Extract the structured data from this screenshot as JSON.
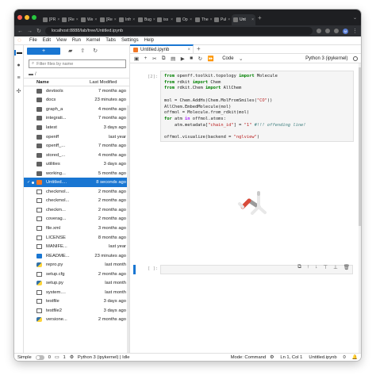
{
  "browser": {
    "tabs": [
      {
        "label": "[PR"
      },
      {
        "label": "[Re"
      },
      {
        "label": "We"
      },
      {
        "label": "[Re"
      },
      {
        "label": "Infr"
      },
      {
        "label": "Bug"
      },
      {
        "label": "iss"
      },
      {
        "label": "Op"
      },
      {
        "label": "The"
      },
      {
        "label": "Pul"
      },
      {
        "label": "Unt",
        "active": true
      }
    ],
    "url": "localhost:8888/lab/tree/Untitled.ipynb",
    "avatar": "M"
  },
  "menu": [
    "File",
    "Edit",
    "View",
    "Run",
    "Kernel",
    "Tabs",
    "Settings",
    "Help"
  ],
  "filebrowser": {
    "new_label": "+",
    "filter_placeholder": "Filter files by name",
    "breadcrumb": "/",
    "col_name": "Name",
    "col_modified": "Last Modified",
    "files": [
      {
        "name": "devtools",
        "modified": "7 months ago",
        "type": "folder"
      },
      {
        "name": "docs",
        "modified": "23 minutes ago",
        "type": "folder"
      },
      {
        "name": "graph_a",
        "modified": "4 months ago",
        "type": "folder"
      },
      {
        "name": "integrati...",
        "modified": "7 months ago",
        "type": "folder"
      },
      {
        "name": "latest",
        "modified": "3 days ago",
        "type": "folder"
      },
      {
        "name": "openff",
        "modified": "last year",
        "type": "folder"
      },
      {
        "name": "openff_...",
        "modified": "7 months ago",
        "type": "folder"
      },
      {
        "name": "stored_...",
        "modified": "4 months ago",
        "type": "folder"
      },
      {
        "name": "utilities",
        "modified": "3 days ago",
        "type": "folder"
      },
      {
        "name": "working...",
        "modified": "5 months ago",
        "type": "folder"
      },
      {
        "name": "Untitled....",
        "modified": "8 seconds ago",
        "type": "notebook",
        "selected": true
      },
      {
        "name": "checkmol...",
        "modified": "2 months ago",
        "type": "doc"
      },
      {
        "name": "checkmol...",
        "modified": "2 months ago",
        "type": "doc"
      },
      {
        "name": "checkm...",
        "modified": "2 months ago",
        "type": "doc"
      },
      {
        "name": "coverag...",
        "modified": "2 months ago",
        "type": "doc"
      },
      {
        "name": "file.xml",
        "modified": "3 months ago",
        "type": "doc"
      },
      {
        "name": "LICENSE",
        "modified": "8 months ago",
        "type": "doc"
      },
      {
        "name": "MANIFE...",
        "modified": "last year",
        "type": "doc"
      },
      {
        "name": "README...",
        "modified": "23 minutes ago",
        "type": "md"
      },
      {
        "name": "repro.py",
        "modified": "last month",
        "type": "py"
      },
      {
        "name": "setup.cfg",
        "modified": "2 months ago",
        "type": "doc"
      },
      {
        "name": "setup.py",
        "modified": "last month",
        "type": "py"
      },
      {
        "name": "system....",
        "modified": "last month",
        "type": "doc"
      },
      {
        "name": "testfile",
        "modified": "3 days ago",
        "type": "doc"
      },
      {
        "name": "testfile2",
        "modified": "3 days ago",
        "type": "doc"
      },
      {
        "name": "versione...",
        "modified": "2 months ago",
        "type": "py"
      }
    ]
  },
  "notebook": {
    "tab_title": "Untitled.ipynb",
    "cell_type": "Code",
    "kernel": "Python 3 (ipykernel)",
    "cell1_prompt": "[2]:",
    "cell2_prompt": "[ ]:"
  },
  "status": {
    "simple_label": "Simple",
    "count1": "0",
    "count2": "1",
    "kernel_state": "Python 3 (ipykernel) | Idle",
    "mode": "Mode: Command",
    "position": "Ln 1, Col 1",
    "filename": "Untitled.ipynb",
    "notif": "0"
  },
  "colors": {
    "accent": "#1976d2",
    "jupyter_orange": "#f37726"
  }
}
